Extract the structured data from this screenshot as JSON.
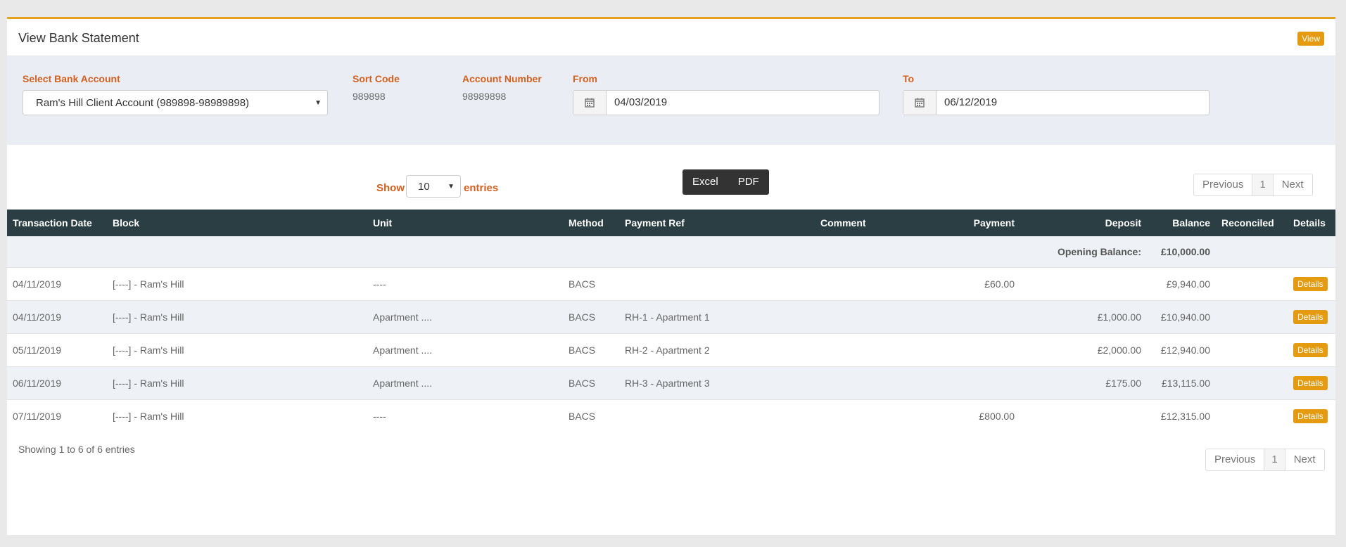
{
  "header": {
    "title": "View Bank Statement",
    "view_button": "View"
  },
  "filters": {
    "bank_account": {
      "label": "Select Bank Account",
      "value": "Ram's Hill Client Account (989898-98989898)"
    },
    "sort_code": {
      "label": "Sort Code",
      "value": "989898"
    },
    "account_number": {
      "label": "Account Number",
      "value": "98989898"
    },
    "from": {
      "label": "From",
      "value": "04/03/2019"
    },
    "to": {
      "label": "To",
      "value": "06/12/2019"
    }
  },
  "controls": {
    "show_label": "Show",
    "page_length": "10",
    "entries_label": "entries",
    "export": [
      "Excel",
      "PDF"
    ],
    "pager": {
      "previous": "Previous",
      "page": "1",
      "next": "Next"
    }
  },
  "table": {
    "columns": [
      "Transaction Date",
      "Block",
      "Unit",
      "Method",
      "Payment Ref",
      "Comment",
      "Payment",
      "Deposit",
      "Balance",
      "Reconciled",
      "Details"
    ],
    "opening_label": "Opening Balance:",
    "opening_value": "£10,000.00",
    "details_label": "Details",
    "rows": [
      {
        "date": "04/11/2019",
        "block": "[----] - Ram's Hill",
        "unit": "----",
        "method": "BACS",
        "ref": "",
        "comment": "",
        "payment": "£60.00",
        "deposit": "",
        "balance": "£9,940.00",
        "reconciled": ""
      },
      {
        "date": "04/11/2019",
        "block": "[----] - Ram's Hill",
        "unit": "Apartment ....",
        "method": "BACS",
        "ref": "RH-1 - Apartment 1",
        "comment": "",
        "payment": "",
        "deposit": "£1,000.00",
        "balance": "£10,940.00",
        "reconciled": ""
      },
      {
        "date": "05/11/2019",
        "block": "[----] - Ram's Hill",
        "unit": "Apartment ....",
        "method": "BACS",
        "ref": "RH-2 - Apartment 2",
        "comment": "",
        "payment": "",
        "deposit": "£2,000.00",
        "balance": "£12,940.00",
        "reconciled": ""
      },
      {
        "date": "06/11/2019",
        "block": "[----] - Ram's Hill",
        "unit": "Apartment ....",
        "method": "BACS",
        "ref": "RH-3 - Apartment 3",
        "comment": "",
        "payment": "",
        "deposit": "£175.00",
        "balance": "£13,115.00",
        "reconciled": ""
      },
      {
        "date": "07/11/2019",
        "block": "[----] - Ram's Hill",
        "unit": "----",
        "method": "BACS",
        "ref": "",
        "comment": "",
        "payment": "£800.00",
        "deposit": "",
        "balance": "£12,315.00",
        "reconciled": ""
      }
    ]
  },
  "footer": {
    "info": "Showing 1 to 6 of 6 entries"
  }
}
